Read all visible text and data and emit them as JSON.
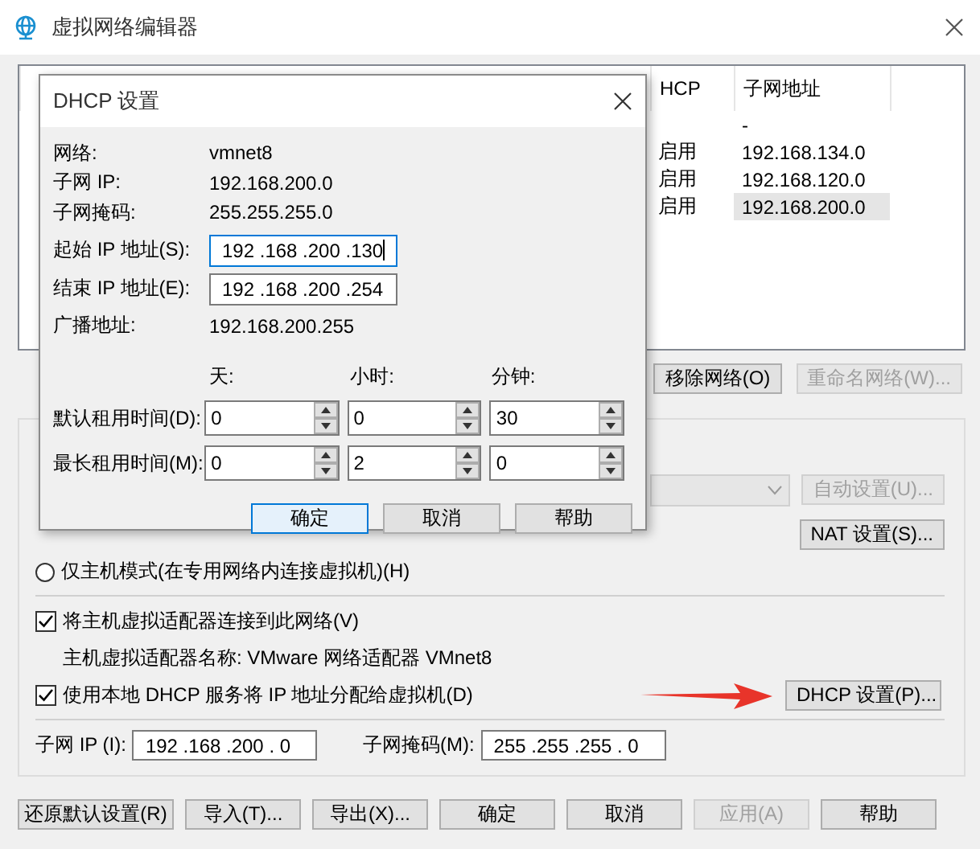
{
  "window": {
    "title": "虚拟网络编辑器"
  },
  "network_table": {
    "columns": [
      "HCP",
      "子网地址"
    ],
    "rows": [
      {
        "subnet": "-",
        "selected": false
      },
      {
        "dhcp": "启用",
        "subnet": "192.168.134.0",
        "selected": false
      },
      {
        "dhcp": "启用",
        "subnet": "192.168.120.0",
        "selected": false
      },
      {
        "dhcp": "启用",
        "subnet": "192.168.200.0",
        "selected": true
      }
    ]
  },
  "network_buttons": [
    {
      "label": "移除网络(O)",
      "disabled": false
    },
    {
      "label": "重命名网络(W)...",
      "disabled": true
    }
  ],
  "nat_dropdown": {
    "disabled": true
  },
  "auto_button": {
    "label": "自动设置(U)...",
    "disabled": true
  },
  "nat_button": {
    "label": "NAT 设置(S)...",
    "disabled": false
  },
  "options": [
    {
      "kind": "radio",
      "label": "仅主机模式(在专用网络内连接虚拟机)(H)",
      "selected": false
    },
    {
      "kind": "divider"
    },
    {
      "kind": "checkbox",
      "label": "将主机虚拟适配器连接到此网络(V)",
      "checked": true
    },
    {
      "kind": "note",
      "label": "主机虚拟适配器名称: VMware 网络适配器 VMnet8"
    },
    {
      "kind": "checkbox",
      "label": "使用本地 DHCP 服务将 IP 地址分配给虚拟机(D)",
      "checked": true,
      "button": "DHCP 设置(P)..."
    }
  ],
  "subnet_ip": {
    "label": "子网 IP (I):",
    "value": "192 .168 .200 . 0"
  },
  "subnet_mask": {
    "label": "子网掩码(M):",
    "value": "255 .255 .255 . 0"
  },
  "footer_buttons": [
    {
      "label": "还原默认设置(R)",
      "disabled": false
    },
    {
      "label": "导入(T)...",
      "disabled": false
    },
    {
      "label": "导出(X)...",
      "disabled": false
    },
    {
      "label": "确定",
      "disabled": false
    },
    {
      "label": "取消",
      "disabled": false
    },
    {
      "label": "应用(A)",
      "disabled": true
    },
    {
      "label": "帮助",
      "disabled": false
    }
  ],
  "dhcp_dialog": {
    "title": "DHCP 设置",
    "info": [
      {
        "label": "网络:",
        "value": "vmnet8"
      },
      {
        "label": "子网 IP:",
        "value": "192.168.200.0"
      },
      {
        "label": "子网掩码:",
        "value": "255.255.255.0"
      }
    ],
    "ranges": [
      {
        "label": "起始 IP 地址(S):",
        "value": "192 .168 .200 .130",
        "focused": true
      },
      {
        "label": "结束 IP 地址(E):",
        "value": "192 .168 .200 .254",
        "focused": false
      }
    ],
    "broadcast": {
      "label": "广播地址:",
      "value": "192.168.200.255"
    },
    "lease_headers": [
      "天:",
      "小时:",
      "分钟:"
    ],
    "leases": [
      {
        "label": "默认租用时间(D):",
        "values": [
          "0",
          "0",
          "30"
        ]
      },
      {
        "label": "最长租用时间(M):",
        "values": [
          "0",
          "2",
          "0"
        ]
      }
    ],
    "buttons": [
      {
        "label": "确定",
        "focused": true
      },
      {
        "label": "取消",
        "focused": false
      },
      {
        "label": "帮助",
        "focused": false
      }
    ]
  }
}
